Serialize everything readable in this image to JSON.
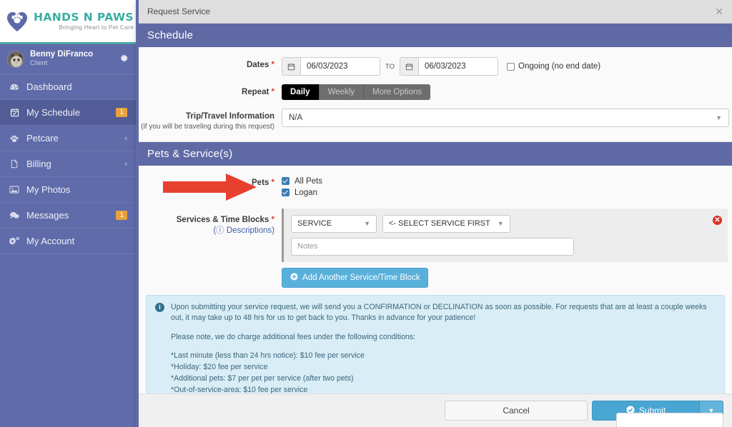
{
  "sidebar": {
    "brand": {
      "title": "HANDS N PAWS",
      "tagline": "Bringing Heart to Pet Care",
      "logo_icon": "heart-paw-logo"
    },
    "profile": {
      "name": "Benny DiFranco",
      "role": "Client",
      "avatar_icon": "cat-avatar",
      "settings_icon": "gear-icon"
    },
    "items": [
      {
        "label": "Dashboard",
        "icon": "dashboard-icon",
        "badge": "",
        "caret": "",
        "active": false
      },
      {
        "label": "My Schedule",
        "icon": "calendar-icon",
        "badge": "1",
        "caret": "",
        "active": true
      },
      {
        "label": "Petcare",
        "icon": "paw-icon",
        "badge": "",
        "caret": "‹",
        "active": false
      },
      {
        "label": "Billing",
        "icon": "document-icon",
        "badge": "",
        "caret": "‹",
        "active": false
      },
      {
        "label": "My Photos",
        "icon": "photo-icon",
        "badge": "",
        "caret": "",
        "active": false
      },
      {
        "label": "Messages",
        "icon": "chat-icon",
        "badge": "1",
        "caret": "",
        "active": false
      },
      {
        "label": "My Account",
        "icon": "cogs-icon",
        "badge": "",
        "caret": "",
        "active": false
      }
    ]
  },
  "modal": {
    "title": "Request Service",
    "close_icon": "close-icon",
    "sections": {
      "schedule": {
        "heading": "Schedule",
        "dates": {
          "label": "Dates",
          "required_mark": "*",
          "start_value": "06/03/2023",
          "end_value": "06/03/2023",
          "to_label": "TO",
          "calendar_icon": "calendar-icon",
          "ongoing_label": "Ongoing (no end date)",
          "ongoing_checked": false
        },
        "repeat": {
          "label": "Repeat",
          "required_mark": "*",
          "options": [
            "Daily",
            "Weekly",
            "More Options"
          ],
          "selected": "Daily"
        },
        "trip": {
          "label": "Trip/Travel Information",
          "sublabel": "(if you will be traveling during this request)",
          "value": "N/A"
        }
      },
      "pets_services": {
        "heading": "Pets & Service(s)",
        "pets": {
          "label": "Pets",
          "required_mark": "*",
          "options": [
            {
              "label": "All Pets",
              "checked": true
            },
            {
              "label": "Logan",
              "checked": true
            }
          ]
        },
        "services": {
          "label": "Services & Time Blocks",
          "required_mark": "*",
          "descriptions_link": "Descriptions",
          "descriptions_icon": "help-circle-icon",
          "rows": [
            {
              "service_value": "SERVICE",
              "time_value": "<- SELECT SERVICE FIRST",
              "notes_placeholder": "Notes",
              "notes_value": "",
              "remove_icon": "remove-circle-icon"
            }
          ],
          "add_button": "Add Another Service/Time Block",
          "add_button_icon": "plus-circle-icon"
        }
      }
    },
    "info": {
      "icon": "info-circle-icon",
      "paragraph1": "Upon submitting your service request, we will send you a CONFIRMATION or DECLINATION as soon as possible. For requests that are at least a couple weeks out, it may take up to 48 hrs for us to get back to you. Thanks in advance for your patience!",
      "paragraph2": "Please note, we do charge additional fees under the following conditions:",
      "fees": [
        "*Last minute (less than 24 hrs notice): $10 fee per service",
        "*Holiday: $20 fee per service",
        "*Additional pets: $7 per pet per service (after two pets)",
        "*Out-of-service-area: $10 fee per service"
      ]
    },
    "footer": {
      "cancel_label": "Cancel",
      "submit_label": "Submit",
      "submit_icon": "check-circle-icon",
      "dropdown_icon": "caret-down-icon"
    }
  },
  "annotation": {
    "arrow_icon": "red-right-arrow",
    "color": "#e8402f"
  },
  "colors": {
    "sidebar_bg": "#606ba9",
    "sidebar_active": "#525c96",
    "brand_teal": "#3aada3",
    "section_header": "#5f6aa4",
    "badge_orange": "#e9a23b",
    "checkbox_blue": "#3d7cb3",
    "submit_blue": "#49a5d1",
    "info_bg": "#d9edf7",
    "required_red": "#e03b3b"
  }
}
